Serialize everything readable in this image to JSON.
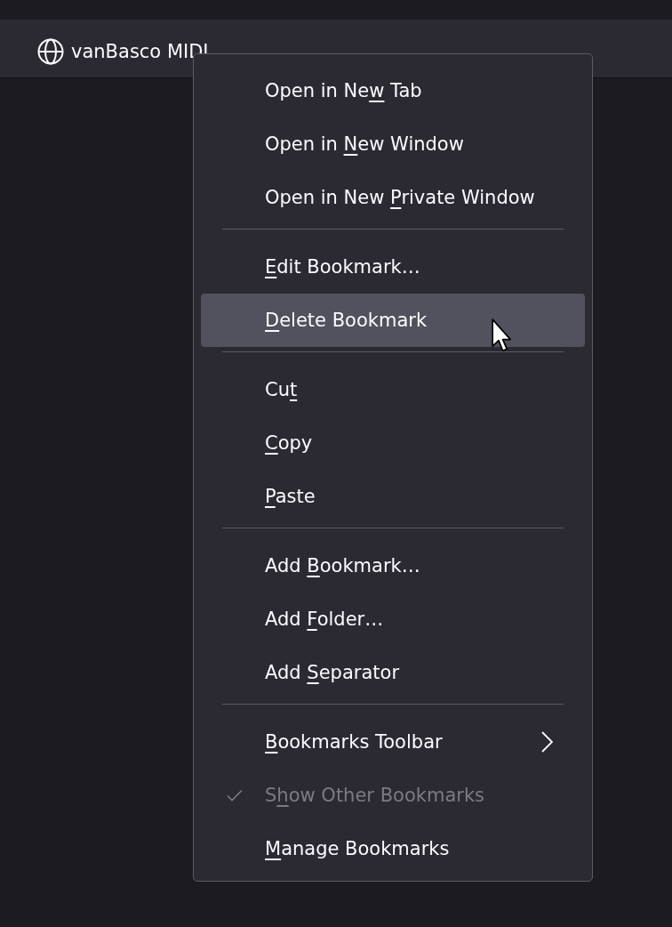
{
  "toolbar": {
    "bookmarks": [
      {
        "label": "vanBasco MIDI"
      }
    ]
  },
  "context_menu": {
    "groups": [
      {
        "items": [
          {
            "label": {
              "before": "Open in Ne",
              "access_key": "w",
              "after": " Tab"
            },
            "selected": false,
            "checked": false,
            "disabled": false,
            "submenu": false
          },
          {
            "label": {
              "before": "Open in ",
              "access_key": "N",
              "after": "ew Window"
            },
            "selected": false,
            "checked": false,
            "disabled": false,
            "submenu": false
          },
          {
            "label": {
              "before": "Open in New ",
              "access_key": "P",
              "after": "rivate Window"
            },
            "selected": false,
            "checked": false,
            "disabled": false,
            "submenu": false
          }
        ]
      },
      {
        "items": [
          {
            "label": {
              "access_key": "E",
              "after": "dit Bookmark…"
            },
            "selected": false,
            "checked": false,
            "disabled": false,
            "submenu": false
          },
          {
            "label": {
              "access_key": "D",
              "after": "elete Bookmark"
            },
            "selected": true,
            "checked": false,
            "disabled": false,
            "submenu": false
          }
        ]
      },
      {
        "items": [
          {
            "label": {
              "before": "Cu",
              "access_key": "t"
            },
            "selected": false,
            "checked": false,
            "disabled": false,
            "submenu": false
          },
          {
            "label": {
              "access_key": "C",
              "after": "opy"
            },
            "selected": false,
            "checked": false,
            "disabled": false,
            "submenu": false
          },
          {
            "label": {
              "access_key": "P",
              "after": "aste"
            },
            "selected": false,
            "checked": false,
            "disabled": false,
            "submenu": false
          }
        ]
      },
      {
        "items": [
          {
            "label": {
              "before": "Add ",
              "access_key": "B",
              "after": "ookmark…"
            },
            "selected": false,
            "checked": false,
            "disabled": false,
            "submenu": false
          },
          {
            "label": {
              "before": "Add ",
              "access_key": "F",
              "after": "older…"
            },
            "selected": false,
            "checked": false,
            "disabled": false,
            "submenu": false
          },
          {
            "label": {
              "before": "Add ",
              "access_key": "S",
              "after": "eparator"
            },
            "selected": false,
            "checked": false,
            "disabled": false,
            "submenu": false
          }
        ]
      },
      {
        "items": [
          {
            "label": {
              "access_key": "B",
              "after": "ookmarks Toolbar"
            },
            "selected": false,
            "checked": false,
            "disabled": false,
            "submenu": true
          },
          {
            "label": {
              "before": "S",
              "access_key": "h",
              "after": "ow Other Bookmarks"
            },
            "selected": false,
            "checked": true,
            "disabled": true,
            "submenu": false
          },
          {
            "label": {
              "access_key": "M",
              "after": "anage Bookmarks"
            },
            "selected": false,
            "checked": false,
            "disabled": false,
            "submenu": false
          }
        ]
      }
    ]
  }
}
